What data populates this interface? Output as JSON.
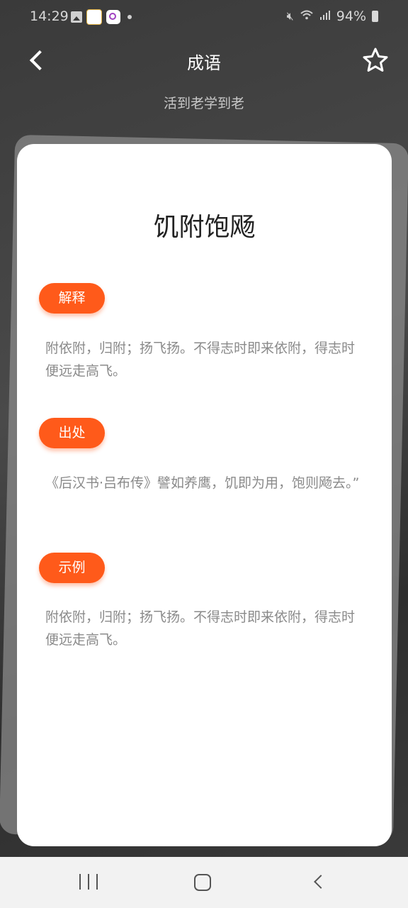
{
  "status_bar": {
    "time": "14:29",
    "battery": "94%",
    "icons": [
      "gallery-icon",
      "app-notification-icon",
      "camera-app-icon",
      "dot-icon",
      "mute-icon",
      "wifi-icon",
      "signal-icon",
      "battery-icon"
    ]
  },
  "header": {
    "title": "成语",
    "subtitle": "活到老学到老"
  },
  "card": {
    "idiom": "饥附饱飏",
    "sections": [
      {
        "tag": "解释",
        "text": "附依附，归附；扬飞扬。不得志时即来依附，得志时便远走高飞。"
      },
      {
        "tag": "出处",
        "text": "《后汉书·吕布传》譬如养鹰，饥即为用，饱则飏去。”"
      },
      {
        "tag": "示例",
        "text": "附依附，归附；扬飞扬。不得志时即来依附，得志时便远走高飞。"
      }
    ]
  },
  "colors": {
    "accent": "#ff5a1a",
    "body_text": "#8a8a8a",
    "card_bg": "#ffffff"
  }
}
